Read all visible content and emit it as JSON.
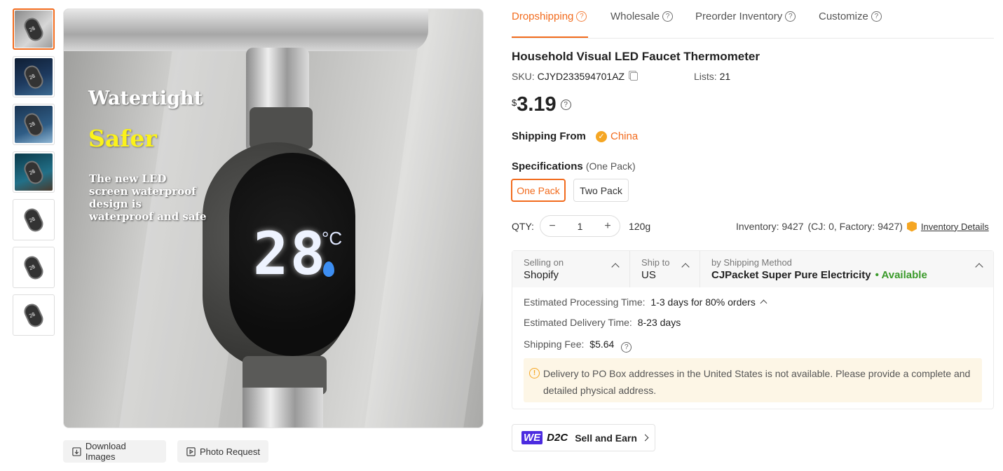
{
  "tabs": [
    {
      "label": "Dropshipping",
      "active": true
    },
    {
      "label": "Wholesale",
      "active": false
    },
    {
      "label": "Preorder Inventory",
      "active": false
    },
    {
      "label": "Customize",
      "active": false
    }
  ],
  "image_overlay": {
    "title": "Watertight",
    "highlight": "Safer",
    "description": "The new LED screen waterproof design is waterproof and safe",
    "display_value": "28",
    "display_unit": "°C"
  },
  "image_actions": {
    "download": "Download Images",
    "photo_request": "Photo Request"
  },
  "product": {
    "title": "Household Visual LED Faucet Thermometer",
    "sku_label": "SKU:",
    "sku": "CJYD233594701AZ",
    "lists_label": "Lists:",
    "lists": "21",
    "currency": "$",
    "price": "3.19"
  },
  "shipping_from": {
    "label": "Shipping From",
    "value": "China"
  },
  "specifications": {
    "label": "Specifications",
    "selected": "(One Pack)",
    "options": [
      "One Pack",
      "Two Pack"
    ]
  },
  "quantity": {
    "label": "QTY:",
    "value": "1",
    "weight": "120g",
    "inventory": "Inventory: 9427",
    "inventory_detail": "(CJ: 0, Factory: 9427)",
    "inventory_link": "Inventory Details"
  },
  "shipping": {
    "selling_on_label": "Selling on",
    "selling_on": "Shopify",
    "ship_to_label": "Ship to",
    "ship_to": "US",
    "method_label": "by Shipping Method",
    "method": "CJPacket Super Pure Electricity",
    "availability": "• Available",
    "processing_label": "Estimated Processing Time:",
    "processing": "1-3 days for 80% orders",
    "delivery_label": "Estimated Delivery Time:",
    "delivery": "8-23 days",
    "fee_label": "Shipping Fee:",
    "fee": "$5.64",
    "notice": "Delivery to PO Box addresses in the United States is not available. Please provide a complete and detailed physical address."
  },
  "d2c": {
    "badge": "WE",
    "tag": "D2C",
    "label": "Sell and Earn"
  },
  "colors": {
    "accent": "#f26b1d",
    "available": "#3a9a2a",
    "notice_bg": "#fdf6e6"
  }
}
